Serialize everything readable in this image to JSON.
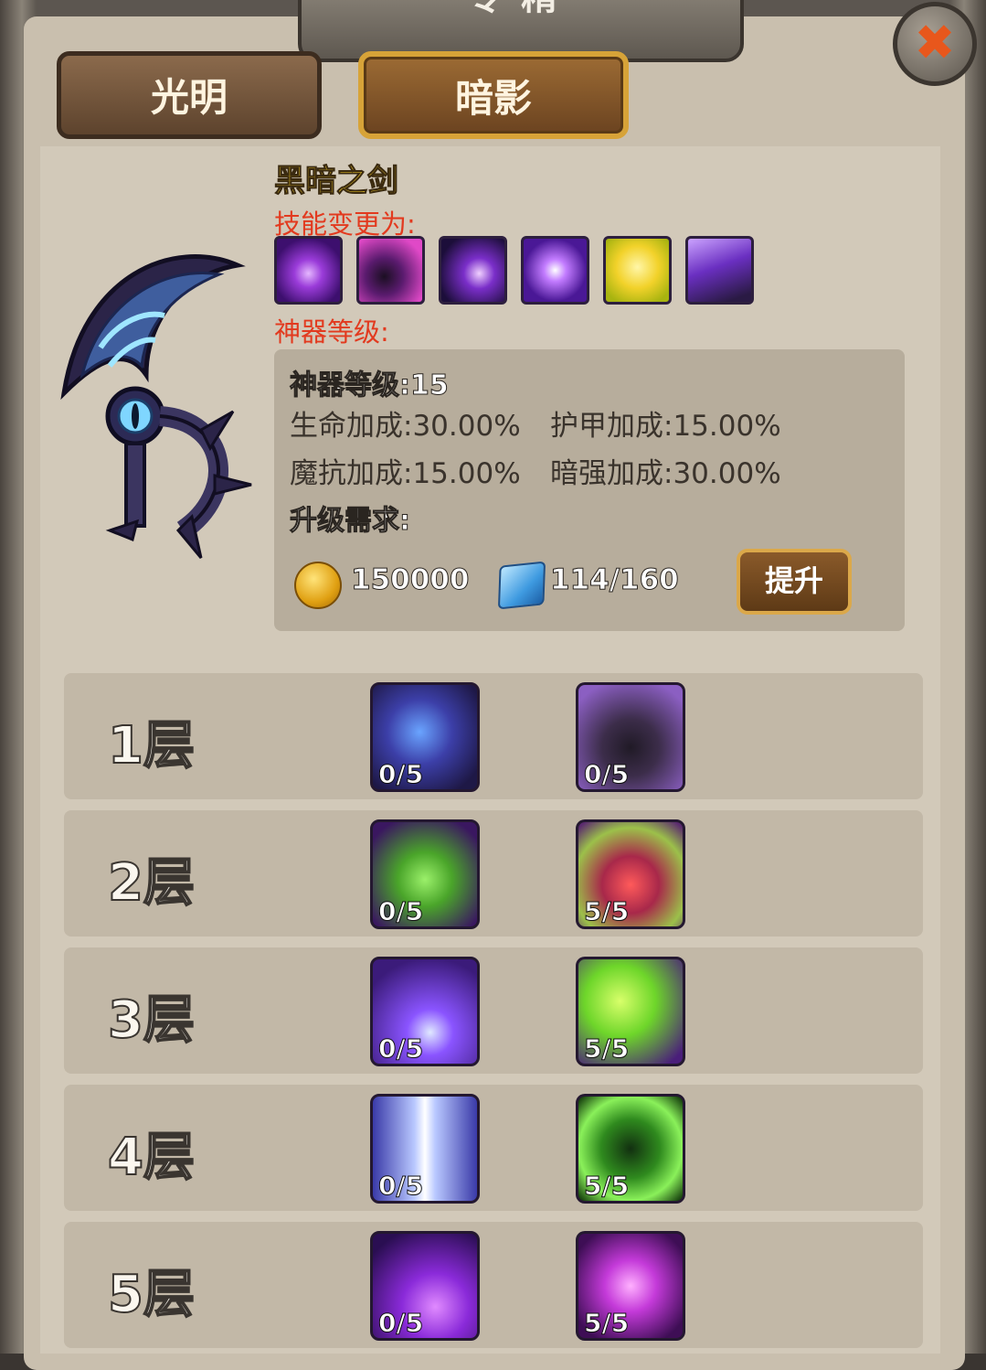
{
  "header": {
    "title": "专精",
    "close_symbol": "✖"
  },
  "tabs": [
    {
      "label": "光明",
      "active": false
    },
    {
      "label": "暗影",
      "active": true
    }
  ],
  "artifact": {
    "name": "黑暗之剑",
    "skill_change_label": "技能变更为:",
    "skill_icons": [
      "dark-orb-icon",
      "shadow-figure-icon",
      "shadow-swarm-icon",
      "void-burst-icon",
      "golden-shield-icon",
      "shadow-summon-icon"
    ],
    "level_label": "神器等级:",
    "level_text": "神器等级:15",
    "stats": {
      "hp": "生命加成:30.00%",
      "armor": "护甲加成:15.00%",
      "magic_resist": "魔抗加成:15.00%",
      "dark_power": "暗强加成:30.00%"
    },
    "requirement_label": "升级需求:",
    "gold_cost": "150000",
    "crystal_progress": "114/160",
    "upgrade_button": "提升"
  },
  "tiers": [
    {
      "label": "1层",
      "talents": [
        {
          "icon": "thunder-titan-icon",
          "count": "0/5"
        },
        {
          "icon": "ghost-shade-icon",
          "count": "0/5"
        }
      ]
    },
    {
      "label": "2层",
      "talents": [
        {
          "icon": "green-flame-spirit-icon",
          "count": "0/5"
        },
        {
          "icon": "fierce-face-icon",
          "count": "5/5"
        }
      ]
    },
    {
      "label": "3层",
      "talents": [
        {
          "icon": "void-flare-icon",
          "count": "0/5"
        },
        {
          "icon": "toxic-burst-icon",
          "count": "5/5"
        }
      ]
    },
    {
      "label": "4层",
      "talents": [
        {
          "icon": "light-beam-icon",
          "count": "0/5"
        },
        {
          "icon": "green-vortex-icon",
          "count": "5/5"
        }
      ]
    },
    {
      "label": "5层",
      "talents": [
        {
          "icon": "violet-storm-icon",
          "count": "0/5"
        },
        {
          "icon": "arcane-dancer-icon",
          "count": "5/5"
        }
      ]
    }
  ]
}
